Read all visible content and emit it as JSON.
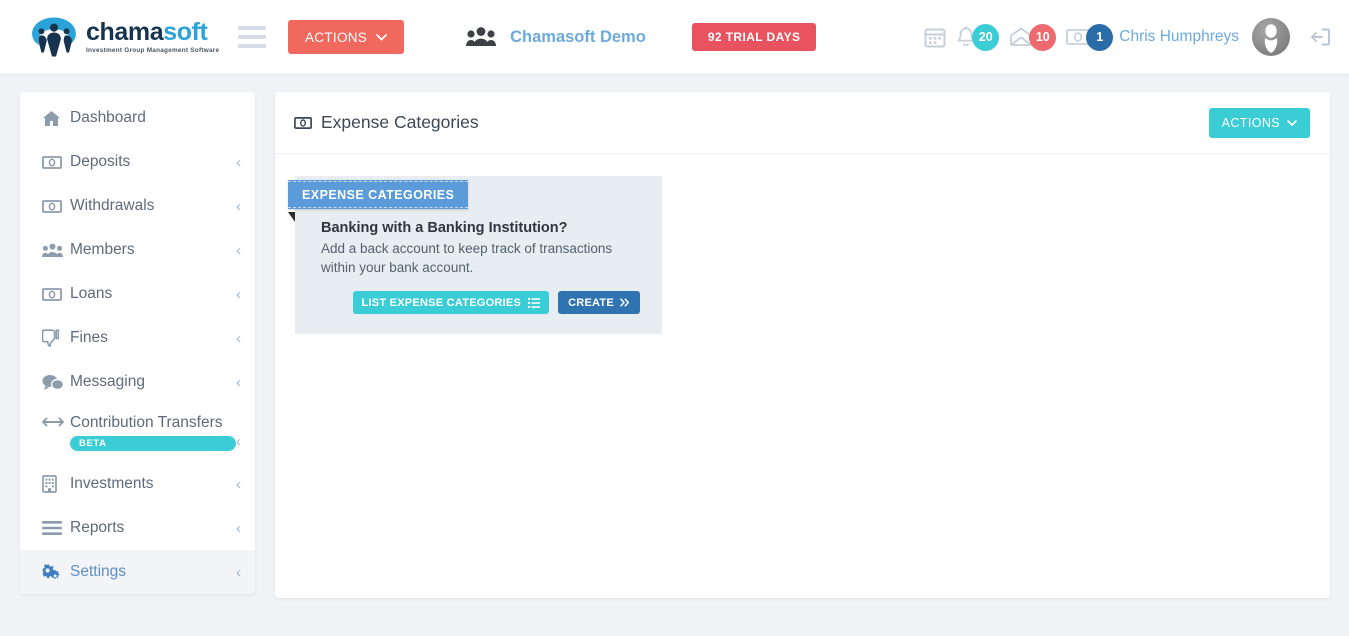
{
  "header": {
    "logo": {
      "icon": "chamasoft-logo-icon",
      "word_primary": "chama",
      "word_secondary": "soft",
      "tagline": "Investment Group Management Software"
    },
    "menu_toggle_icon": "hamburger-icon",
    "actions_button": {
      "label": "ACTIONS",
      "icon": "chevron-down-icon",
      "color": "#f1685e"
    },
    "group": {
      "icon": "users-icon",
      "name": "Chamasoft Demo"
    },
    "trial_badge": {
      "label": "92 TRIAL DAYS",
      "color": "#e8535f"
    },
    "notifications": [
      {
        "icon": "calendar-icon",
        "count": "",
        "badge_color": ""
      },
      {
        "icon": "bell-icon",
        "count": "20",
        "badge_color": "#3bcdd6"
      },
      {
        "icon": "envelope-open-icon",
        "count": "10",
        "badge_color": "#ee6a71"
      },
      {
        "icon": "money-icon",
        "count": "1",
        "badge_color": "#2a6ca8"
      }
    ],
    "user": {
      "name": "Chris Humphreys",
      "avatar_icon": "user-avatar-icon"
    },
    "logout_icon": "sign-out-icon"
  },
  "sidebar": {
    "items": [
      {
        "label": "Dashboard",
        "icon": "home-icon",
        "chevron": "",
        "active": false,
        "badge": ""
      },
      {
        "label": "Deposits",
        "icon": "money-icon",
        "chevron": "‹",
        "active": false,
        "badge": ""
      },
      {
        "label": "Withdrawals",
        "icon": "money-icon",
        "chevron": "‹",
        "active": false,
        "badge": ""
      },
      {
        "label": "Members",
        "icon": "users-icon",
        "chevron": "‹",
        "active": false,
        "badge": ""
      },
      {
        "label": "Loans",
        "icon": "money-icon",
        "chevron": "‹",
        "active": false,
        "badge": ""
      },
      {
        "label": "Fines",
        "icon": "thumbs-down-icon",
        "chevron": "‹",
        "active": false,
        "badge": ""
      },
      {
        "label": "Messaging",
        "icon": "comments-icon",
        "chevron": "‹",
        "active": false,
        "badge": ""
      },
      {
        "label": "Contribution Transfers",
        "icon": "arrows-h-icon",
        "chevron": "‹",
        "active": false,
        "badge": "BETA"
      },
      {
        "label": "Investments",
        "icon": "building-icon",
        "chevron": "‹",
        "active": false,
        "badge": ""
      },
      {
        "label": "Reports",
        "icon": "bars-icon",
        "chevron": "‹",
        "active": false,
        "badge": ""
      },
      {
        "label": "Settings",
        "icon": "gears-icon",
        "chevron": "‹",
        "active": true,
        "badge": ""
      }
    ]
  },
  "main": {
    "title": "Expense Categories",
    "title_icon": "money-icon",
    "actions_button": {
      "label": "ACTIONS",
      "icon": "chevron-down-icon",
      "color": "#3bcdd6"
    },
    "promo_card": {
      "ribbon": "EXPENSE CATEGORIES",
      "heading": "Banking with a Banking Institution?",
      "body": "Add a back account to keep track of transactions within your bank account.",
      "buttons": [
        {
          "label": "LIST EXPENSE CATEGORIES",
          "icon": "list-icon",
          "color": "#3bcdd6"
        },
        {
          "label": "CREATE",
          "icon": "double-angle-right-icon",
          "color": "#2f74b0"
        }
      ]
    }
  }
}
